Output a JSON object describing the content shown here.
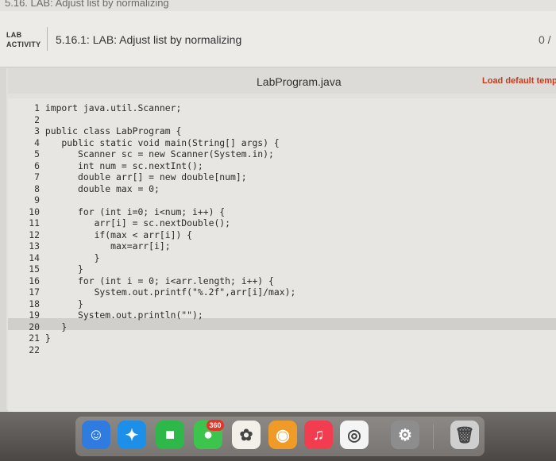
{
  "breadcrumb": "5.16. LAB: Adjust list by normalizing",
  "header": {
    "badge_line1": "LAB",
    "badge_line2": "ACTIVITY",
    "title": "5.16.1: LAB: Adjust list by normalizing",
    "score": "0 /"
  },
  "editor": {
    "file_name": "LabProgram.java",
    "load_default": "Load default templ",
    "lines": [
      {
        "n": "1",
        "code": "import java.util.Scanner;"
      },
      {
        "n": "2",
        "code": ""
      },
      {
        "n": "3",
        "code": "public class LabProgram {"
      },
      {
        "n": "4",
        "code": "   public static void main(String[] args) {"
      },
      {
        "n": "5",
        "code": "      Scanner sc = new Scanner(System.in);"
      },
      {
        "n": "6",
        "code": "      int num = sc.nextInt();"
      },
      {
        "n": "7",
        "code": "      double arr[] = new double[num];"
      },
      {
        "n": "8",
        "code": "      double max = 0;"
      },
      {
        "n": "9",
        "code": ""
      },
      {
        "n": "10",
        "code": "      for (int i=0; i<num; i++) {"
      },
      {
        "n": "11",
        "code": "         arr[i] = sc.nextDouble();"
      },
      {
        "n": "12",
        "code": "         if(max < arr[i]) {"
      },
      {
        "n": "13",
        "code": "            max=arr[i];"
      },
      {
        "n": "14",
        "code": "         }"
      },
      {
        "n": "15",
        "code": "      }"
      },
      {
        "n": "16",
        "code": "      for (int i = 0; i<arr.length; i++) {"
      },
      {
        "n": "17",
        "code": "         System.out.printf(\"%.2f\",arr[i]/max);"
      },
      {
        "n": "18",
        "code": "      }"
      },
      {
        "n": "19",
        "code": "      System.out.println(\"\");"
      },
      {
        "n": "20",
        "code": "   }"
      },
      {
        "n": "21",
        "code": "}"
      },
      {
        "n": "22",
        "code": ""
      }
    ]
  },
  "dock": {
    "messages_badge": "360",
    "icons": [
      {
        "name": "finder-icon",
        "color": "#2f7be0",
        "glyph": "☺"
      },
      {
        "name": "safari-icon",
        "color": "#1d8fe8",
        "glyph": "✦"
      },
      {
        "name": "facetime-icon",
        "color": "#2fb84a",
        "glyph": "■"
      },
      {
        "name": "messages-icon",
        "color": "#3cc44c",
        "glyph": "●"
      },
      {
        "name": "photos-icon",
        "color": "#f3f0ea",
        "glyph": "✿"
      },
      {
        "name": "app-orange-icon",
        "color": "#f09a28",
        "glyph": "◉"
      },
      {
        "name": "music-icon",
        "color": "#f23c4f",
        "glyph": "♫"
      },
      {
        "name": "chrome-icon",
        "color": "#f4f4f4",
        "glyph": "◎"
      },
      {
        "name": "settings-icon",
        "color": "#8d8d8d",
        "glyph": "⚙"
      },
      {
        "name": "trash-icon",
        "color": "#cfcfcf",
        "glyph": "🗑"
      }
    ]
  }
}
